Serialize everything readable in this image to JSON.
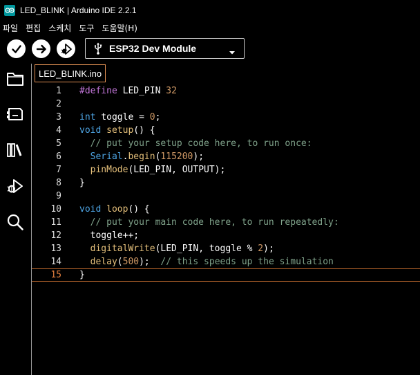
{
  "window": {
    "title": "LED_BLINK | Arduino IDE 2.2.1"
  },
  "menu": [
    {
      "label": "파일"
    },
    {
      "label": "편집"
    },
    {
      "label": "스케치"
    },
    {
      "label": "도구"
    },
    {
      "label": "도움말(H)"
    }
  ],
  "toolbar": {
    "verify_icon": "checkmark-icon",
    "upload_icon": "arrow-right-icon",
    "debug_icon": "debug-icon",
    "board_icon": "usb-icon",
    "board": "ESP32 Dev Module"
  },
  "sidebar": {
    "items": [
      {
        "icon": "folder-icon"
      },
      {
        "icon": "board-manager-icon"
      },
      {
        "icon": "library-icon"
      },
      {
        "icon": "debug-icon"
      },
      {
        "icon": "search-icon"
      }
    ]
  },
  "tabs": [
    {
      "label": "LED_BLINK.ino"
    }
  ],
  "editor": {
    "current_line": 15,
    "lines": [
      {
        "num": "1",
        "tokens": [
          {
            "t": "#define",
            "c": "pre"
          },
          {
            "t": " LED_PIN ",
            "c": "pl"
          },
          {
            "t": "32",
            "c": "num"
          }
        ]
      },
      {
        "num": "2",
        "tokens": []
      },
      {
        "num": "3",
        "tokens": [
          {
            "t": "int",
            "c": "kw"
          },
          {
            "t": " toggle = ",
            "c": "pl"
          },
          {
            "t": "0",
            "c": "num"
          },
          {
            "t": ";",
            "c": "pl"
          }
        ]
      },
      {
        "num": "4",
        "tokens": [
          {
            "t": "void",
            "c": "kw"
          },
          {
            "t": " ",
            "c": "pl"
          },
          {
            "t": "setup",
            "c": "fn"
          },
          {
            "t": "() {",
            "c": "pl"
          }
        ]
      },
      {
        "num": "5",
        "tokens": [
          {
            "t": "  // put your setup code here, to run once:",
            "c": "cm"
          }
        ]
      },
      {
        "num": "6",
        "tokens": [
          {
            "t": "  ",
            "c": "pl"
          },
          {
            "t": "Serial",
            "c": "kw"
          },
          {
            "t": ".",
            "c": "pl"
          },
          {
            "t": "begin",
            "c": "fn"
          },
          {
            "t": "(",
            "c": "pl"
          },
          {
            "t": "115200",
            "c": "num"
          },
          {
            "t": ");",
            "c": "pl"
          }
        ]
      },
      {
        "num": "7",
        "tokens": [
          {
            "t": "  ",
            "c": "pl"
          },
          {
            "t": "pinMode",
            "c": "fn"
          },
          {
            "t": "(LED_PIN, OUTPUT);",
            "c": "pl"
          }
        ]
      },
      {
        "num": "8",
        "tokens": [
          {
            "t": "}",
            "c": "pl"
          }
        ]
      },
      {
        "num": "9",
        "tokens": []
      },
      {
        "num": "10",
        "tokens": [
          {
            "t": "void",
            "c": "kw"
          },
          {
            "t": " ",
            "c": "pl"
          },
          {
            "t": "loop",
            "c": "fn"
          },
          {
            "t": "() {",
            "c": "pl"
          }
        ]
      },
      {
        "num": "11",
        "tokens": [
          {
            "t": "  // put your main code here, to run repeatedly:",
            "c": "cm"
          }
        ]
      },
      {
        "num": "12",
        "tokens": [
          {
            "t": "  toggle++;",
            "c": "pl"
          }
        ]
      },
      {
        "num": "13",
        "tokens": [
          {
            "t": "  ",
            "c": "pl"
          },
          {
            "t": "digitalWrite",
            "c": "fn"
          },
          {
            "t": "(LED_PIN, toggle % ",
            "c": "pl"
          },
          {
            "t": "2",
            "c": "num"
          },
          {
            "t": ");",
            "c": "pl"
          }
        ]
      },
      {
        "num": "14",
        "tokens": [
          {
            "t": "  ",
            "c": "pl"
          },
          {
            "t": "delay",
            "c": "fn"
          },
          {
            "t": "(",
            "c": "pl"
          },
          {
            "t": "500",
            "c": "num"
          },
          {
            "t": ");  ",
            "c": "pl"
          },
          {
            "t": "// this speeds up the simulation",
            "c": "cm"
          }
        ]
      },
      {
        "num": "15",
        "tokens": [
          {
            "t": "}",
            "c": "pl"
          }
        ]
      }
    ]
  },
  "colors": {
    "background": "#000000",
    "accent": "#e5813f",
    "keyword": "#4ea6e6",
    "preprocessor": "#c678dd",
    "number": "#d19a66",
    "function": "#e5c07b",
    "comment": "#7fa28a"
  }
}
